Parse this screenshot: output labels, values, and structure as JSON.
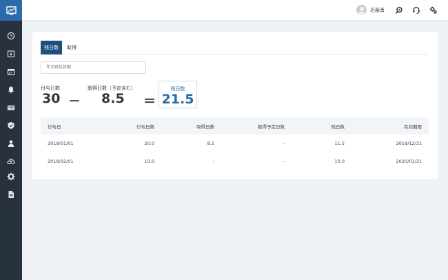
{
  "header": {
    "user_name": "近藤勇"
  },
  "tabs": [
    {
      "label": "残日数"
    },
    {
      "label": "取得"
    }
  ],
  "filter": {
    "selected": "年次有給休暇"
  },
  "summary": {
    "granted_label": "付与日数",
    "granted_value": "30",
    "minus": "－",
    "taken_label": "取得日数（予定含む）",
    "taken_value": "8.5",
    "equals": "＝",
    "remaining_label": "残日数",
    "remaining_value": "21.5"
  },
  "table": {
    "headers": [
      "付与日",
      "付与日数",
      "取得日数",
      "取得予定日数",
      "残日数",
      "有効期限"
    ],
    "rows": [
      [
        "2018/01/01",
        "20.0",
        "8.5",
        "-",
        "11.5",
        "2019/12/31"
      ],
      [
        "2018/02/01",
        "10.0",
        "-",
        "-",
        "10.0",
        "2020/01/31"
      ]
    ]
  },
  "icons": {
    "sidebar": [
      "clock-icon",
      "download-icon",
      "calendar-icon",
      "bell-icon",
      "card-icon",
      "shield-icon",
      "person-icon",
      "cloud-icon",
      "gear-icon",
      "document-icon"
    ],
    "top": [
      "search-icon",
      "headset-icon",
      "settings-icon"
    ]
  },
  "colors": {
    "sidebar_bg": "#27323e",
    "logo_bg": "#2c6aa8",
    "active_tab": "#1f4e80",
    "accent": "#2c6aa8",
    "background": "#eef2f5"
  }
}
